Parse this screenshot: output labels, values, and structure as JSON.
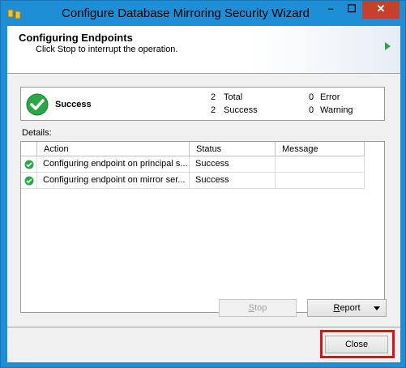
{
  "window": {
    "title": "Configure Database Mirroring Security Wizard",
    "controls": {
      "minimize": "–",
      "maximize": "☐",
      "close": "✕"
    }
  },
  "header": {
    "title": "Configuring Endpoints",
    "subtitle": "Click Stop to interrupt the operation."
  },
  "summary": {
    "status": "Success",
    "total_count": "2",
    "total_label": "Total",
    "success_count": "2",
    "success_label": "Success",
    "error_count": "0",
    "error_label": "Error",
    "warning_count": "0",
    "warning_label": "Warning"
  },
  "details": {
    "label": "Details:",
    "columns": [
      "Action",
      "Status",
      "Message"
    ],
    "rows": [
      {
        "action": "Configuring endpoint on principal s...",
        "status": "Success",
        "message": ""
      },
      {
        "action": "Configuring endpoint on mirror ser...",
        "status": "Success",
        "message": ""
      }
    ]
  },
  "buttons": {
    "stop_u": "S",
    "stop_rest": "top",
    "report_u": "R",
    "report_rest": "eport",
    "close": "Close"
  },
  "colors": {
    "title_bar": "#1e8fd6",
    "close_button": "#c7402c",
    "success_green": "#2aa845",
    "highlight": "#e0101a"
  },
  "icons": {
    "app": "database-mirroring-icon",
    "summary": "success-check-icon",
    "row": "success-check-icon",
    "header": "arrow-right-icon"
  }
}
